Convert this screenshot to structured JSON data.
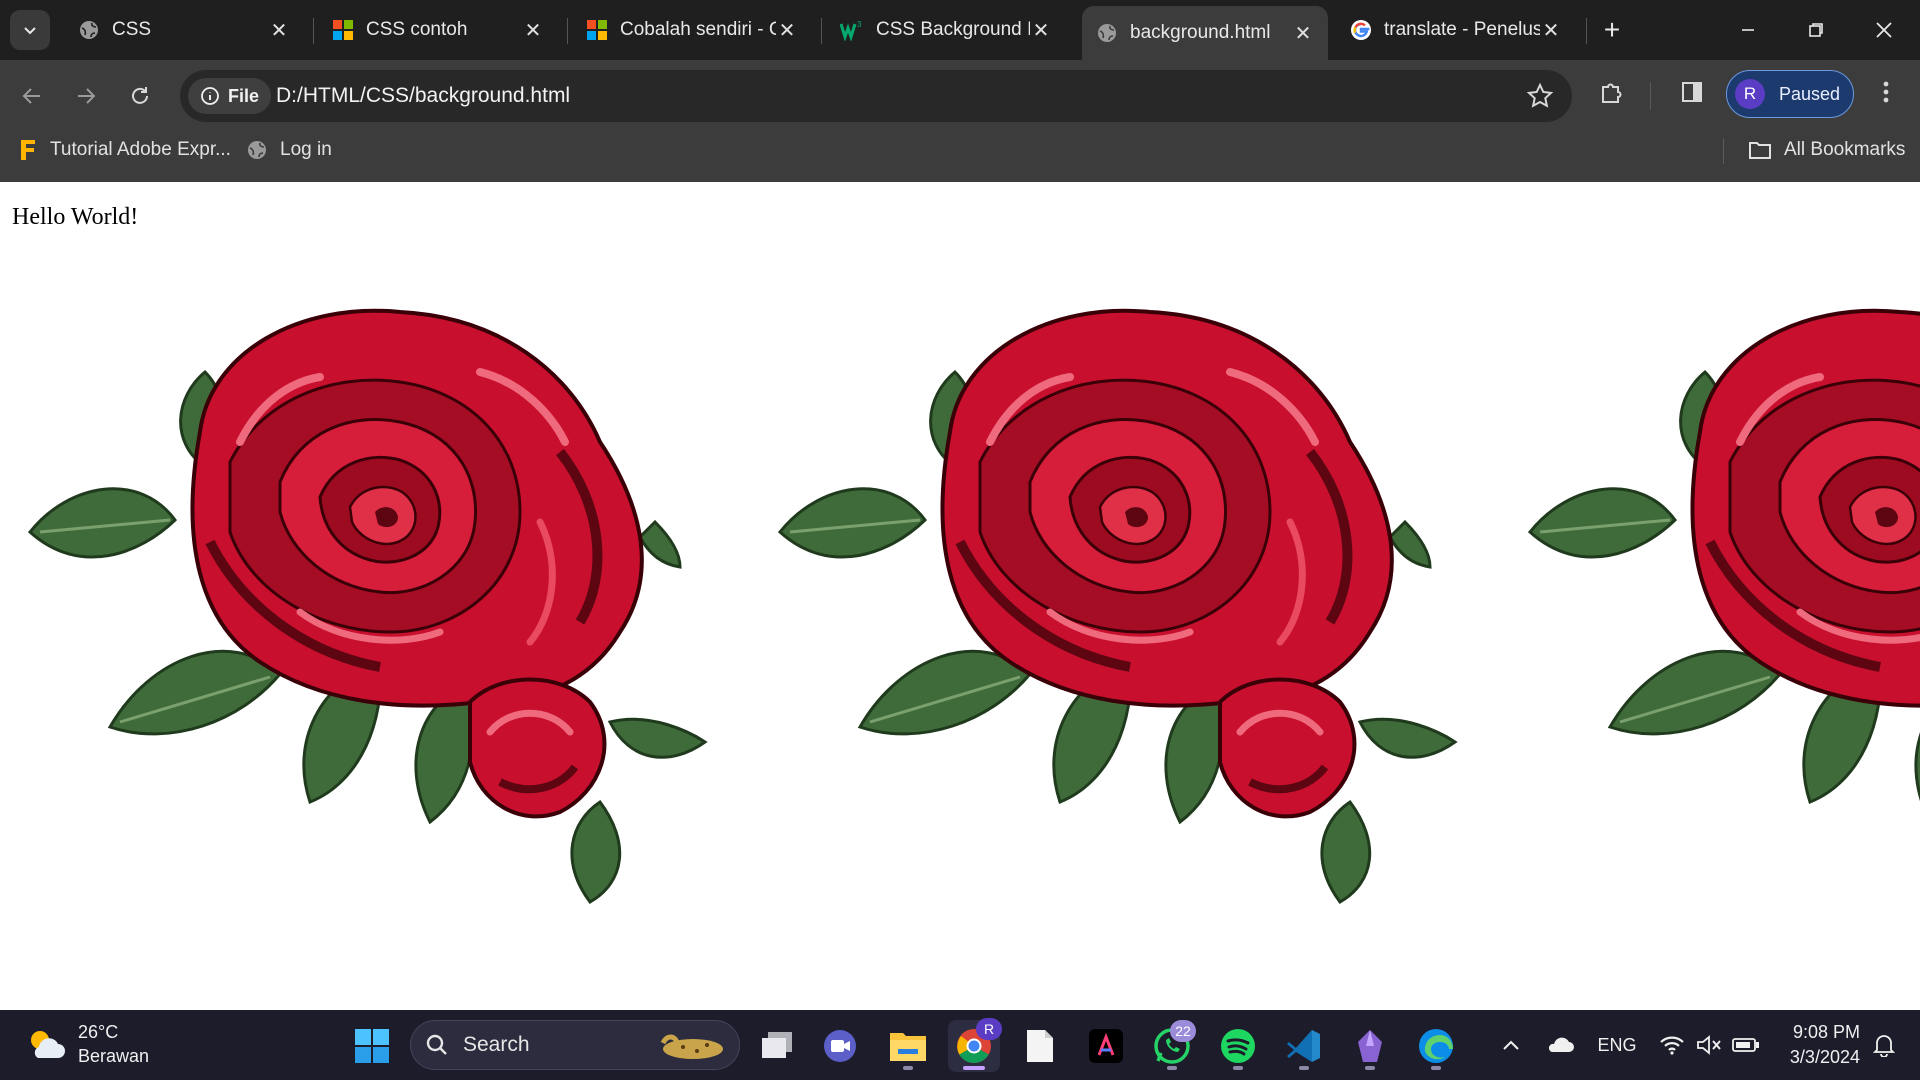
{
  "browser": {
    "tabs": [
      {
        "title": "CSS",
        "icon": "globe-icon"
      },
      {
        "title": "CSS contoh",
        "icon": "microsoft-logo-icon"
      },
      {
        "title": "Cobalah sendiri - C",
        "icon": "microsoft-logo-icon"
      },
      {
        "title": "CSS Background Ir",
        "icon": "w3schools-icon"
      },
      {
        "title": "background.html",
        "icon": "globe-icon",
        "active": true
      },
      {
        "title": "translate - Penelus",
        "icon": "google-icon"
      }
    ],
    "address_chip": "File",
    "url": "D:/HTML/CSS/background.html",
    "profile_initial": "R",
    "profile_status": "Paused",
    "bookmarks": [
      {
        "title": "Tutorial Adobe Expr...",
        "icon": "adobe-express-icon"
      },
      {
        "title": "Log in",
        "icon": "globe-icon"
      }
    ],
    "all_bookmarks": "All Bookmarks"
  },
  "page": {
    "text": "Hello World!",
    "background_image": "red-rose-illustration",
    "background_repeat": "repeat-x"
  },
  "taskbar": {
    "weather_temp": "26°C",
    "weather_desc": "Berawan",
    "search_placeholder": "Search",
    "whatsapp_badge": "22",
    "chrome_badge": "R",
    "language": "ENG",
    "time": "9:08 PM",
    "date": "3/3/2024"
  },
  "colors": {
    "tab_strip": "#1f1f1f",
    "toolbar": "#3c3c3c",
    "taskbar": "#1c1c2b",
    "rose_red": "#c8102e",
    "leaf_green": "#3f6b3a"
  }
}
